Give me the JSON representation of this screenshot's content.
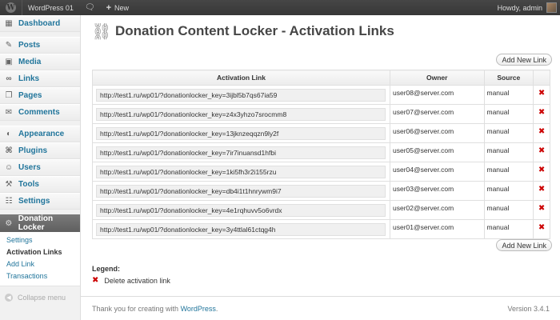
{
  "adminbar": {
    "site_name": "WordPress 01",
    "comments_icon": "speech-bubble-icon",
    "new_label": "New",
    "howdy": "Howdy, admin"
  },
  "sidebar": {
    "items": [
      {
        "label": "Dashboard",
        "icon": "dashboard-icon"
      },
      {
        "label": "Posts",
        "icon": "pin-icon"
      },
      {
        "label": "Media",
        "icon": "media-icon"
      },
      {
        "label": "Links",
        "icon": "link-icon"
      },
      {
        "label": "Pages",
        "icon": "page-icon"
      },
      {
        "label": "Comments",
        "icon": "comment-icon"
      },
      {
        "label": "Appearance",
        "icon": "appearance-icon"
      },
      {
        "label": "Plugins",
        "icon": "plugin-icon"
      },
      {
        "label": "Users",
        "icon": "users-icon"
      },
      {
        "label": "Tools",
        "icon": "tools-icon"
      },
      {
        "label": "Settings",
        "icon": "settings-icon"
      }
    ],
    "active": {
      "label": "Donation Locker",
      "icon": "gear-icon"
    },
    "submenu": [
      "Settings",
      "Activation Links",
      "Add Link",
      "Transactions"
    ],
    "collapse_label": "Collapse menu"
  },
  "page": {
    "title": "Donation Content Locker - Activation Links",
    "add_button": "Add New Link"
  },
  "table": {
    "headers": [
      "Activation Link",
      "Owner",
      "Source",
      ""
    ],
    "rows": [
      {
        "link": "http://test1.ru/wp01/?donationlocker_key=3ijbl5b7qs67ia59",
        "owner": "user08@server.com",
        "source": "manual"
      },
      {
        "link": "http://test1.ru/wp01/?donationlocker_key=z4x3yhzo7srocmm8",
        "owner": "user07@server.com",
        "source": "manual"
      },
      {
        "link": "http://test1.ru/wp01/?donationlocker_key=13jknzeqqzn9ly2f",
        "owner": "user06@server.com",
        "source": "manual"
      },
      {
        "link": "http://test1.ru/wp01/?donationlocker_key=7ir7inuansd1hfbi",
        "owner": "user05@server.com",
        "source": "manual"
      },
      {
        "link": "http://test1.ru/wp01/?donationlocker_key=1ki5fh3r2i155rzu",
        "owner": "user04@server.com",
        "source": "manual"
      },
      {
        "link": "http://test1.ru/wp01/?donationlocker_key=db4i1t1hnrywm9i7",
        "owner": "user03@server.com",
        "source": "manual"
      },
      {
        "link": "http://test1.ru/wp01/?donationlocker_key=4e1rqhuvv5o6vrdx",
        "owner": "user02@server.com",
        "source": "manual"
      },
      {
        "link": "http://test1.ru/wp01/?donationlocker_key=3y4ttlal61ctqg4h",
        "owner": "user01@server.com",
        "source": "manual"
      }
    ]
  },
  "legend": {
    "title": "Legend:",
    "delete_text": "Delete activation link"
  },
  "footer": {
    "thanks_prefix": "Thank you for creating with ",
    "thanks_link": "WordPress",
    "thanks_suffix": ".",
    "version": "Version 3.4.1"
  },
  "colors": {
    "link": "#21759b",
    "delete": "#cc0000",
    "adminbar": "#464646"
  }
}
